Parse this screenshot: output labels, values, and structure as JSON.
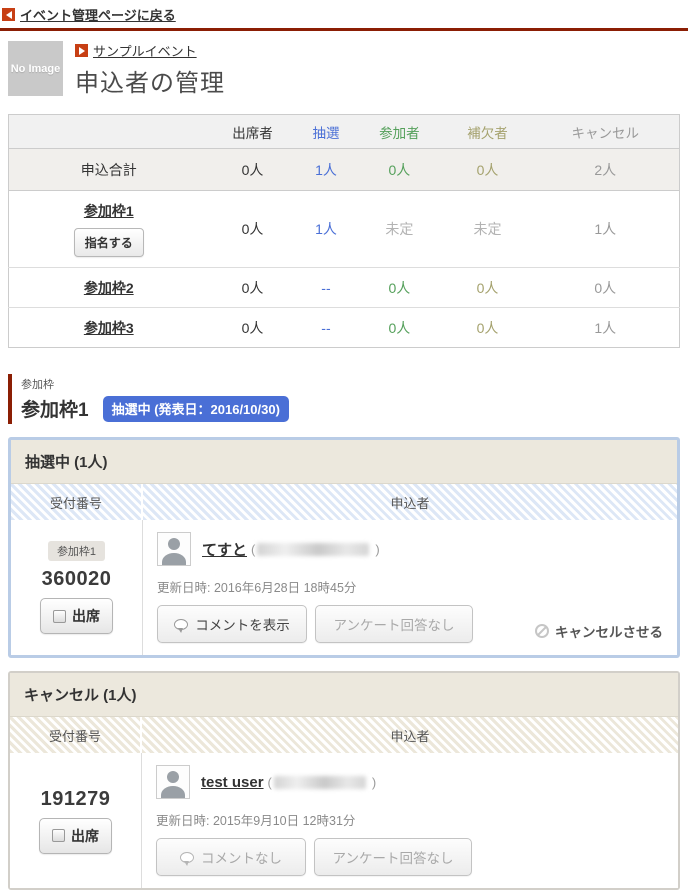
{
  "header": {
    "back_link": "イベント管理ページに戻る",
    "no_image_label": "No Image",
    "event_link": "サンプルイベント",
    "page_title": "申込者の管理"
  },
  "colors": {
    "accent_rule_red": "#8b1e04",
    "arrow_icon_orange": "#c73f14",
    "lottery_blue": "#4a6fd6",
    "participant_green": "#55a05b",
    "waitlist_olive": "#a5a26e",
    "cancel_gray": "#999999",
    "badge_blue": "#4a6fd6",
    "panel_border_blue": "#b9cce6",
    "panel_header_beige": "#ece8dd"
  },
  "summary_table": {
    "columns": [
      "出席者",
      "抽選",
      "参加者",
      "補欠者",
      "キャンセル"
    ],
    "rows": [
      {
        "label": "申込合計",
        "values": [
          "0人",
          "1人",
          "0人",
          "0人",
          "2人"
        ]
      },
      {
        "label": "参加枠1",
        "button": "指名する",
        "values": [
          "0人",
          "1人",
          "未定",
          "未定",
          "1人"
        ]
      },
      {
        "label": "参加枠2",
        "values": [
          "0人",
          "--",
          "0人",
          "0人",
          "0人"
        ]
      },
      {
        "label": "参加枠3",
        "values": [
          "0人",
          "--",
          "0人",
          "0人",
          "1人"
        ]
      }
    ]
  },
  "section": {
    "eyebrow": "参加枠",
    "title": "参加枠1",
    "badge": "抽選中 (発表日：2016/10/30)"
  },
  "panels": [
    {
      "title": "抽選中 (1人)",
      "col_receipt": "受付番号",
      "col_applicant": "申込者",
      "entry": {
        "slot_badge": "参加枠1",
        "receipt_number": "360020",
        "attend_label": "出席",
        "name": "てすと",
        "paren_open": "(",
        "paren_close": ")",
        "updated": "更新日時: 2016年6月28日 18時45分",
        "comment_button": "コメントを表示",
        "survey_button": "アンケート回答なし",
        "cancel_link": "キャンセルさせる"
      }
    },
    {
      "title": "キャンセル (1人)",
      "col_receipt": "受付番号",
      "col_applicant": "申込者",
      "entry": {
        "receipt_number": "191279",
        "attend_label": "出席",
        "name": "test user",
        "paren_open": "(",
        "paren_close": ")",
        "updated": "更新日時: 2015年9月10日 12時31分",
        "comment_button": "コメントなし",
        "survey_button": "アンケート回答なし"
      }
    }
  ]
}
